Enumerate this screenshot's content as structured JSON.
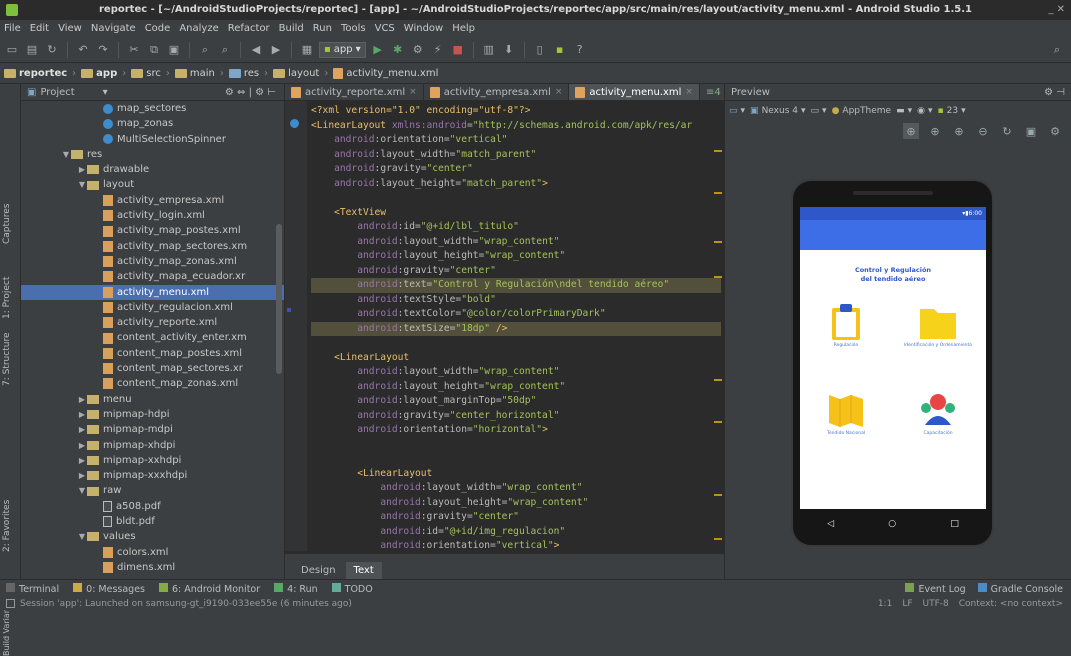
{
  "window": {
    "title": "reportec - [~/AndroidStudioProjects/reportec] - [app] - ~/AndroidStudioProjects/reportec/app/src/main/res/layout/activity_menu.xml - Android Studio 1.5.1",
    "controls": "_ ✕"
  },
  "menu": [
    "File",
    "Edit",
    "View",
    "Navigate",
    "Code",
    "Analyze",
    "Refactor",
    "Build",
    "Run",
    "Tools",
    "VCS",
    "Window",
    "Help"
  ],
  "toolbar": {
    "run_config": "app"
  },
  "breadcrumb": [
    "reportec",
    "app",
    "src",
    "main",
    "res",
    "layout",
    "activity_menu.xml"
  ],
  "left_strip": [
    "1: Project",
    "7: Structure",
    "2: Favorites",
    "Build Variants",
    "Captures"
  ],
  "project": {
    "header": "Project",
    "tree": [
      {
        "depth": 5,
        "icon": "cls",
        "label": "map_sectores",
        "arrow": ""
      },
      {
        "depth": 5,
        "icon": "cls",
        "label": "map_zonas",
        "arrow": ""
      },
      {
        "depth": 5,
        "icon": "cls",
        "label": "MultiSelectionSpinner",
        "arrow": ""
      },
      {
        "depth": 3,
        "icon": "fold",
        "label": "res",
        "arrow": "▼"
      },
      {
        "depth": 4,
        "icon": "fold",
        "label": "drawable",
        "arrow": "▶"
      },
      {
        "depth": 4,
        "icon": "fold",
        "label": "layout",
        "arrow": "▼"
      },
      {
        "depth": 5,
        "icon": "xml",
        "label": "activity_empresa.xml",
        "arrow": ""
      },
      {
        "depth": 5,
        "icon": "xml",
        "label": "activity_login.xml",
        "arrow": ""
      },
      {
        "depth": 5,
        "icon": "xml",
        "label": "activity_map_postes.xml",
        "arrow": ""
      },
      {
        "depth": 5,
        "icon": "xml",
        "label": "activity_map_sectores.xm",
        "arrow": ""
      },
      {
        "depth": 5,
        "icon": "xml",
        "label": "activity_map_zonas.xml",
        "arrow": ""
      },
      {
        "depth": 5,
        "icon": "xml",
        "label": "activity_mapa_ecuador.xr",
        "arrow": ""
      },
      {
        "depth": 5,
        "icon": "xml",
        "label": "activity_menu.xml",
        "arrow": "",
        "selected": true
      },
      {
        "depth": 5,
        "icon": "xml",
        "label": "activity_regulacion.xml",
        "arrow": ""
      },
      {
        "depth": 5,
        "icon": "xml",
        "label": "activity_reporte.xml",
        "arrow": ""
      },
      {
        "depth": 5,
        "icon": "xml",
        "label": "content_activity_enter.xm",
        "arrow": ""
      },
      {
        "depth": 5,
        "icon": "xml",
        "label": "content_map_postes.xml",
        "arrow": ""
      },
      {
        "depth": 5,
        "icon": "xml",
        "label": "content_map_sectores.xr",
        "arrow": ""
      },
      {
        "depth": 5,
        "icon": "xml",
        "label": "content_map_zonas.xml",
        "arrow": ""
      },
      {
        "depth": 4,
        "icon": "fold",
        "label": "menu",
        "arrow": "▶"
      },
      {
        "depth": 4,
        "icon": "fold",
        "label": "mipmap-hdpi",
        "arrow": "▶"
      },
      {
        "depth": 4,
        "icon": "fold",
        "label": "mipmap-mdpi",
        "arrow": "▶"
      },
      {
        "depth": 4,
        "icon": "fold",
        "label": "mipmap-xhdpi",
        "arrow": "▶"
      },
      {
        "depth": 4,
        "icon": "fold",
        "label": "mipmap-xxhdpi",
        "arrow": "▶"
      },
      {
        "depth": 4,
        "icon": "fold",
        "label": "mipmap-xxxhdpi",
        "arrow": "▶"
      },
      {
        "depth": 4,
        "icon": "fold",
        "label": "raw",
        "arrow": "▼"
      },
      {
        "depth": 5,
        "icon": "file",
        "label": "a508.pdf",
        "arrow": ""
      },
      {
        "depth": 5,
        "icon": "file",
        "label": "bldt.pdf",
        "arrow": ""
      },
      {
        "depth": 4,
        "icon": "fold",
        "label": "values",
        "arrow": "▼"
      },
      {
        "depth": 5,
        "icon": "xml",
        "label": "colors.xml",
        "arrow": ""
      },
      {
        "depth": 5,
        "icon": "xml",
        "label": "dimens.xml",
        "arrow": ""
      }
    ]
  },
  "editor": {
    "tabs": [
      {
        "label": "activity_reporte.xml",
        "active": false
      },
      {
        "label": "activity_empresa.xml",
        "active": false
      },
      {
        "label": "activity_menu.xml",
        "active": true
      }
    ],
    "overflow": "≡4",
    "lines": [
      [
        [
          "pi",
          "<?xml version=\"1.0\" encoding=\"utf-8\"?>"
        ]
      ],
      [
        [
          "tag",
          "<LinearLayout "
        ],
        [
          "ns",
          "xmlns:android"
        ],
        [
          "attr",
          "="
        ],
        [
          "val",
          "\"http://schemas.android.com/apk/res/ar"
        ]
      ],
      [
        [
          "attr",
          "    "
        ],
        [
          "ns",
          "android"
        ],
        [
          "attr",
          ":orientation="
        ],
        [
          "val",
          "\"vertical\""
        ]
      ],
      [
        [
          "attr",
          "    "
        ],
        [
          "ns",
          "android"
        ],
        [
          "attr",
          ":layout_width="
        ],
        [
          "val",
          "\"match_parent\""
        ]
      ],
      [
        [
          "attr",
          "    "
        ],
        [
          "ns",
          "android"
        ],
        [
          "attr",
          ":gravity="
        ],
        [
          "val",
          "\"center\""
        ]
      ],
      [
        [
          "attr",
          "    "
        ],
        [
          "ns",
          "android"
        ],
        [
          "attr",
          ":layout_height="
        ],
        [
          "val",
          "\"match_parent\""
        ],
        [
          "tag",
          ">"
        ]
      ],
      [],
      [
        [
          "tag",
          "    <TextView"
        ]
      ],
      [
        [
          "attr",
          "        "
        ],
        [
          "ns",
          "android"
        ],
        [
          "attr",
          ":id="
        ],
        [
          "val",
          "\"@+id/lbl_titulo\""
        ]
      ],
      [
        [
          "attr",
          "        "
        ],
        [
          "ns",
          "android"
        ],
        [
          "attr",
          ":layout_width="
        ],
        [
          "val",
          "\"wrap_content\""
        ]
      ],
      [
        [
          "attr",
          "        "
        ],
        [
          "ns",
          "android"
        ],
        [
          "attr",
          ":layout_height="
        ],
        [
          "val",
          "\"wrap_content\""
        ]
      ],
      [
        [
          "attr",
          "        "
        ],
        [
          "ns",
          "android"
        ],
        [
          "attr",
          ":gravity="
        ],
        [
          "val",
          "\"center\""
        ]
      ],
      [
        [
          "attr",
          "        "
        ],
        [
          "ns",
          "android"
        ],
        [
          "attr",
          ":text="
        ],
        [
          "val",
          "\"Control y Regulación\\ndel tendido aéreo\""
        ]
      ],
      [
        [
          "attr",
          "        "
        ],
        [
          "ns",
          "android"
        ],
        [
          "attr",
          ":textStyle="
        ],
        [
          "val",
          "\"bold\""
        ]
      ],
      [
        [
          "attr",
          "        "
        ],
        [
          "ns",
          "android"
        ],
        [
          "attr",
          ":textColor="
        ],
        [
          "val",
          "\"@color/colorPrimaryDark\""
        ]
      ],
      [
        [
          "attr",
          "        "
        ],
        [
          "ns",
          "android"
        ],
        [
          "attr",
          ":textSize="
        ],
        [
          "val",
          "\"18dp\""
        ],
        [
          "tag",
          " />"
        ]
      ],
      [],
      [
        [
          "tag",
          "    <LinearLayout"
        ]
      ],
      [
        [
          "attr",
          "        "
        ],
        [
          "ns",
          "android"
        ],
        [
          "attr",
          ":layout_width="
        ],
        [
          "val",
          "\"wrap_content\""
        ]
      ],
      [
        [
          "attr",
          "        "
        ],
        [
          "ns",
          "android"
        ],
        [
          "attr",
          ":layout_height="
        ],
        [
          "val",
          "\"wrap_content\""
        ]
      ],
      [
        [
          "attr",
          "        "
        ],
        [
          "ns",
          "android"
        ],
        [
          "attr",
          ":layout_marginTop="
        ],
        [
          "val",
          "\"50dp\""
        ]
      ],
      [
        [
          "attr",
          "        "
        ],
        [
          "ns",
          "android"
        ],
        [
          "attr",
          ":gravity="
        ],
        [
          "val",
          "\"center_horizontal\""
        ]
      ],
      [
        [
          "attr",
          "        "
        ],
        [
          "ns",
          "android"
        ],
        [
          "attr",
          ":orientation="
        ],
        [
          "val",
          "\"horizontal\""
        ],
        [
          "tag",
          ">"
        ]
      ],
      [],
      [],
      [
        [
          "tag",
          "        <LinearLayout"
        ]
      ],
      [
        [
          "attr",
          "            "
        ],
        [
          "ns",
          "android"
        ],
        [
          "attr",
          ":layout_width="
        ],
        [
          "val",
          "\"wrap_content\""
        ]
      ],
      [
        [
          "attr",
          "            "
        ],
        [
          "ns",
          "android"
        ],
        [
          "attr",
          ":layout_height="
        ],
        [
          "val",
          "\"wrap_content\""
        ]
      ],
      [
        [
          "attr",
          "            "
        ],
        [
          "ns",
          "android"
        ],
        [
          "attr",
          ":gravity="
        ],
        [
          "val",
          "\"center\""
        ]
      ],
      [
        [
          "attr",
          "            "
        ],
        [
          "ns",
          "android"
        ],
        [
          "attr",
          ":id="
        ],
        [
          "val",
          "\"@+id/img_regulacion\""
        ]
      ],
      [
        [
          "attr",
          "            "
        ],
        [
          "ns",
          "android"
        ],
        [
          "attr",
          ":orientation="
        ],
        [
          "val",
          "\"vertical\""
        ],
        [
          "tag",
          ">"
        ]
      ]
    ],
    "bottom_tabs": [
      {
        "label": "Design",
        "active": false
      },
      {
        "label": "Text",
        "active": true
      }
    ]
  },
  "preview": {
    "title": "Preview",
    "device": "Nexus 4",
    "theme": "AppTheme",
    "api": "23",
    "phone": {
      "time": "6:00",
      "title": "Control y Regulación\ndel tendido aéreo",
      "items": [
        {
          "label": "Regulación",
          "icon": "clipboard-icon",
          "color": "#f6c21a"
        },
        {
          "label": "Identificación y Ordenamiento",
          "icon": "folder-icon",
          "color": "#f6d21a"
        },
        {
          "label": "Tendido Nacional",
          "icon": "map-icon",
          "color": "#f6c21a"
        },
        {
          "label": "Capacitación",
          "icon": "people-icon",
          "color": "#e84545"
        }
      ]
    }
  },
  "tool_windows": {
    "left": [
      {
        "label": "Terminal",
        "icon": "terminal-icon"
      },
      {
        "label": "0: Messages",
        "icon": "messages-icon"
      },
      {
        "label": "6: Android Monitor",
        "icon": "android-icon"
      },
      {
        "label": "4: Run",
        "icon": "run-icon"
      },
      {
        "label": "TODO",
        "icon": "todo-icon"
      }
    ],
    "right": [
      {
        "label": "Event Log",
        "icon": "event-log-icon"
      },
      {
        "label": "Gradle Console",
        "icon": "gradle-icon"
      }
    ]
  },
  "statusbar": {
    "message": "Session 'app': Launched on samsung-gt_i9190-033ee55e (6 minutes ago)",
    "position": "1:1",
    "line_sep": "LF",
    "encoding": "UTF-8",
    "context": "Context: <no context>"
  }
}
